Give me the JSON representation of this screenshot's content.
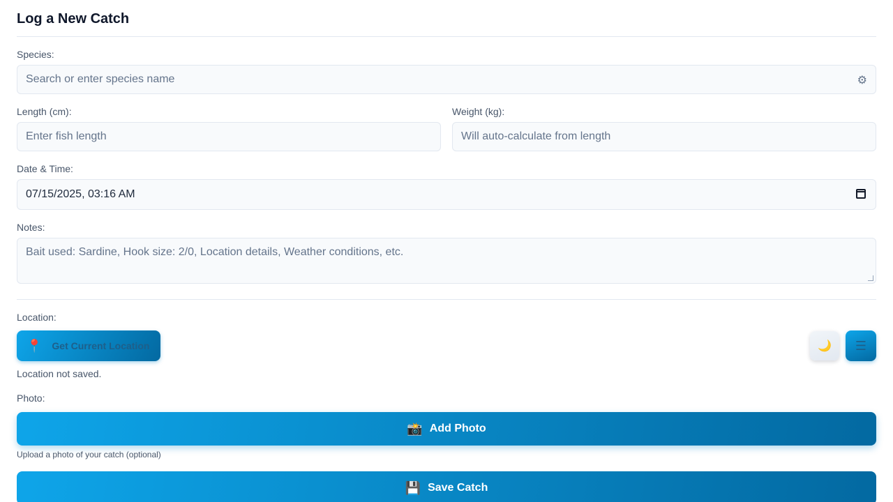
{
  "header": {
    "title": "Log a New Catch"
  },
  "species": {
    "label": "Species:",
    "placeholder": "Search or enter species name",
    "icon": "gear-icon"
  },
  "length": {
    "label": "Length (cm):",
    "placeholder": "Enter fish length"
  },
  "weight": {
    "label": "Weight (kg):",
    "placeholder": "Will auto-calculate from length"
  },
  "datetime": {
    "label": "Date & Time:",
    "value": "07/15/2025, 03:16 AM",
    "icon": "calendar-icon"
  },
  "notes": {
    "label": "Notes:",
    "placeholder": "Bait used: Sardine, Hook size: 2/0, Location details, Weather conditions, etc."
  },
  "location": {
    "label": "Location:",
    "button_label": "Get Current Location",
    "button_icon": "map-pin-icon",
    "status": "Location not saved."
  },
  "controls": {
    "theme_icon": "moon-icon",
    "menu_icon": "hamburger-menu-icon"
  },
  "photo": {
    "label": "Photo:",
    "button_label": "Add Photo",
    "button_icon": "camera-icon",
    "hint": "Upload a photo of your catch (optional)"
  },
  "save": {
    "button_label": "Save Catch",
    "button_icon": "floppy-disk-icon"
  },
  "colors": {
    "accent_start": "#0ea5e9",
    "accent_end": "#0369a1",
    "field_bg": "#f8fafc",
    "border": "#e2e8f0"
  }
}
